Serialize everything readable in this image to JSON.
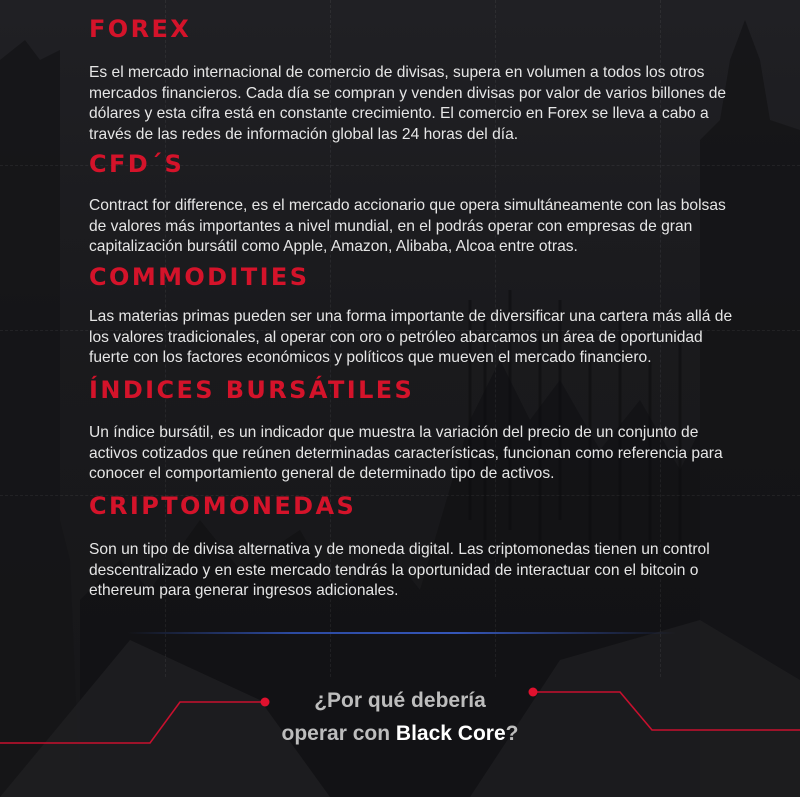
{
  "theme": {
    "accent": "#d4132a",
    "text": "#e6e6e6",
    "background": "#1b1b1e",
    "divider": "#2c4aa0"
  },
  "sections": [
    {
      "title": "FOREX",
      "body": "Es el mercado internacional de comercio de divisas, supera en volumen a todos los otros mercados financieros. Cada día se compran y venden divisas por valor de varios billones de dólares y esta cifra está en constante crecimiento. El comercio en Forex se lleva a cabo a través de las redes de información global las 24 horas del día."
    },
    {
      "title": "CFD´S",
      "body": "Contract for difference, es el mercado accionario que opera simultáneamente con las bolsas de valores más importantes a nivel mundial, en el podrás operar con empresas de gran capitalización bursátil como Apple, Amazon, Alibaba, Alcoa entre otras."
    },
    {
      "title": "COMMODITIES",
      "body": "Las materias primas pueden ser una forma importante de diversificar una cartera más allá de los valores tradicionales, al operar con oro o petróleo abarcamos un área de oportunidad fuerte con los factores económicos y políticos que mueven el mercado financiero."
    },
    {
      "title": "ÍNDICES BURSÁTILES",
      "body": "Un índice bursátil, es un indicador que muestra la variación del precio de un conjunto de activos cotizados que reúnen determinadas características, funcionan como referencia para conocer el comportamiento general de determinado tipo de activos."
    },
    {
      "title": "CRIPTOMONEDAS",
      "body": "Son un tipo de divisa alternativa y de moneda digital. Las criptomonedas tienen un control descentralizado y en este mercado tendrás la oportunidad de interactuar con el bitcoin o ethereum para generar ingresos adicionales."
    }
  ],
  "cta": {
    "line1": "¿Por qué debería",
    "line2_prefix": "operar con ",
    "line2_brand": "Black Core",
    "line2_suffix": "?"
  }
}
